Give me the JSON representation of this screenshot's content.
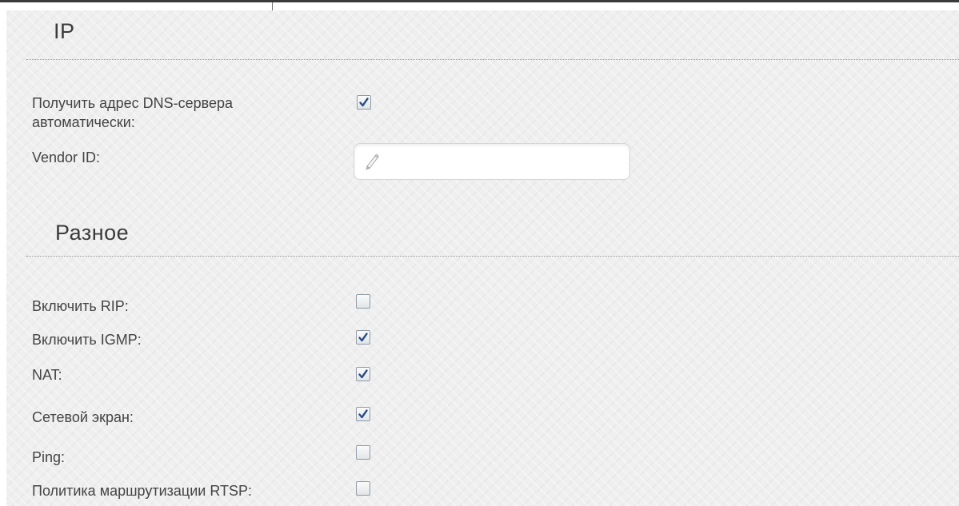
{
  "sections": {
    "ip": {
      "title": "IP",
      "fields": {
        "dns_auto": {
          "label": "Получить адрес DNS-сервера\nавтоматически:",
          "checked": true
        },
        "vendor_id": {
          "label": "Vendor ID:",
          "value": "",
          "placeholder": "",
          "icon": "pencil-icon"
        }
      }
    },
    "misc": {
      "title": "Разное",
      "fields": [
        {
          "label": "Включить RIP:",
          "checked": false
        },
        {
          "label": "Включить IGMP:",
          "checked": true
        },
        {
          "label": "NAT:",
          "checked": true
        },
        {
          "label": "Сетевой экран:",
          "checked": true
        },
        {
          "label": "Ping:",
          "checked": false
        },
        {
          "label": "Политика маршрутизации RTSP:",
          "checked": false
        }
      ]
    }
  },
  "colors": {
    "check_mark": "#2a4f86",
    "label_text": "#444444",
    "panel_bg": "#efefef"
  }
}
